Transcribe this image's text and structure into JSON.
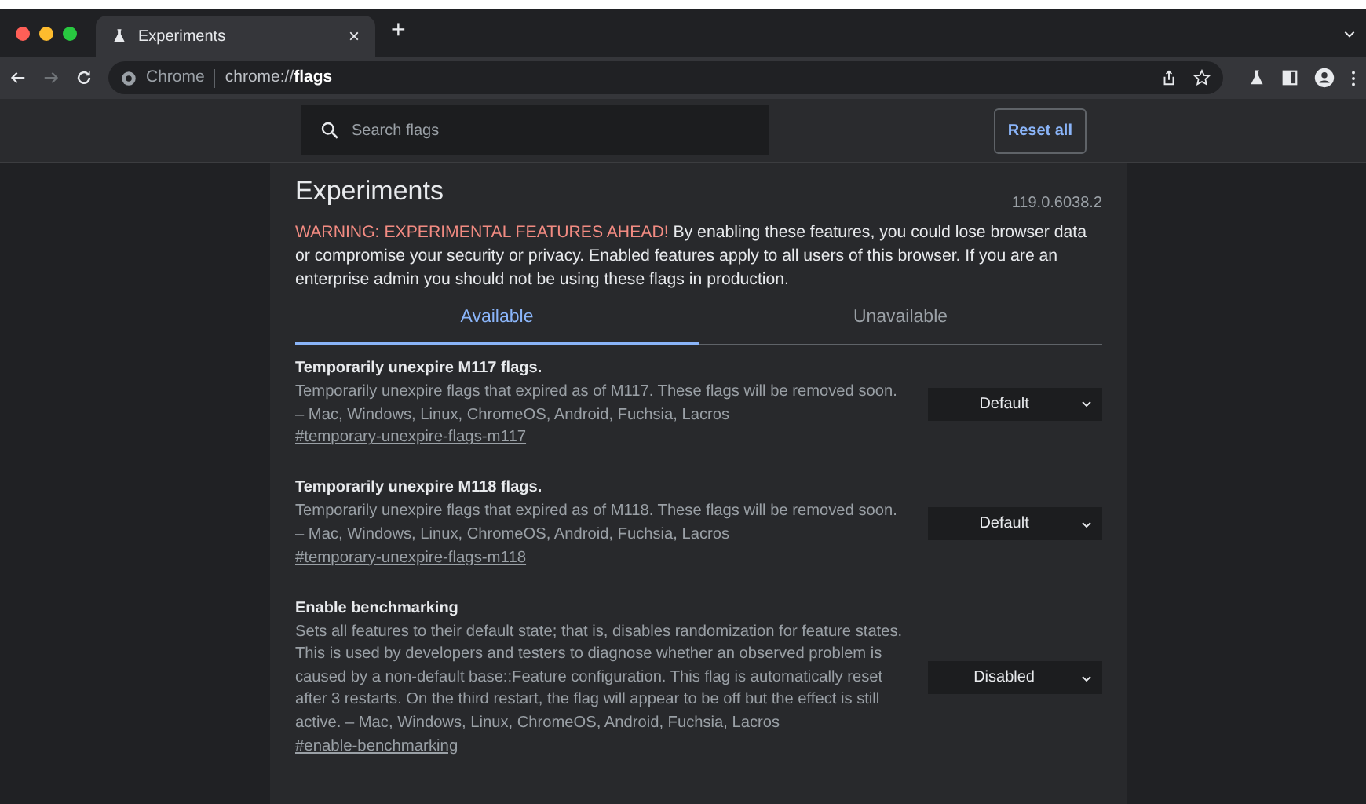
{
  "browser": {
    "tabs": [
      {
        "title": "Experiments",
        "close": "×",
        "selected": true
      }
    ],
    "new_tab": "+",
    "nav_buttons": [
      {
        "kind": "back",
        "disabled": false
      },
      {
        "kind": "forward",
        "disabled": true
      },
      {
        "kind": "reload",
        "disabled": false
      }
    ],
    "address": {
      "site": "Chrome",
      "url": "chrome://**flags**"
    }
  },
  "header": {
    "search": {
      "placeholder": "Search flags"
    },
    "reset_button": "Reset all"
  },
  "page": {
    "title": "Experiments",
    "version": "119.0.6038.2",
    "warning_label": "WARNING: EXPERIMENTAL FEATURES AHEAD!",
    "warning_text": "By enabling these features, you could lose browser data or compromise your security or privacy. Enabled features apply to all users of this browser. If you are an enterprise admin you should not be using these flags in production.",
    "tabs": [
      {
        "label": "Available",
        "selected": true
      },
      {
        "label": "Unavailable",
        "selected": false
      }
    ],
    "flags": [
      {
        "name": "Temporarily unexpire M117 flags.",
        "description": "Temporarily unexpire flags that expired as of M117. These flags will be removed soon. – Mac, Windows, Linux, ChromeOS, Android, Fuchsia, Lacros",
        "link": "#temporary-unexpire-flags-m117",
        "value": "Default"
      },
      {
        "name": "Temporarily unexpire M118 flags.",
        "description": "Temporarily unexpire flags that expired as of M118. These flags will be removed soon. – Mac, Windows, Linux, ChromeOS, Android, Fuchsia, Lacros",
        "link": "#temporary-unexpire-flags-m118",
        "value": "Default"
      },
      {
        "name": "Enable benchmarking",
        "description": "Sets all features to their default state; that is, disables randomization for feature states. This is used by developers and testers to diagnose whether an observed problem is caused by a non-default base::Feature configuration. This flag is automatically reset after 3 restarts. On the third restart, the flag will appear to be off but the effect is still active. – Mac, Windows, Linux, ChromeOS, Android, Fuchsia, Lacros",
        "link": "#enable-benchmarking",
        "value": "Disabled"
      }
    ]
  }
}
